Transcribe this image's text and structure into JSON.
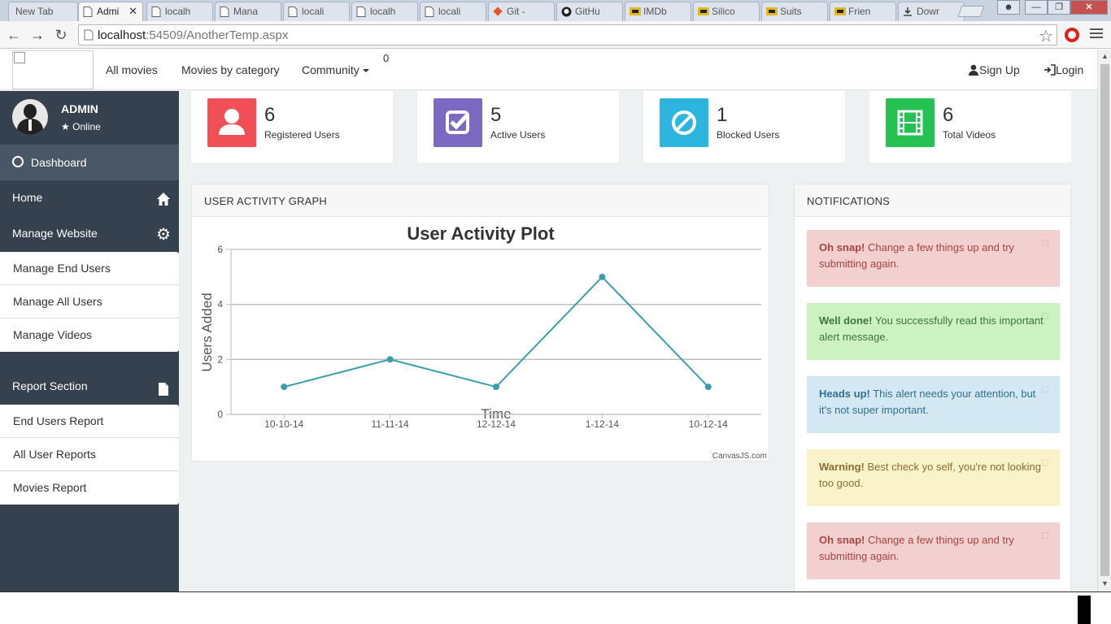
{
  "browser": {
    "tabs": [
      {
        "label": "New Tab",
        "icon": "none"
      },
      {
        "label": "Admi",
        "icon": "page-icon",
        "active": true
      },
      {
        "label": "localh",
        "icon": "page-icon"
      },
      {
        "label": "Mana",
        "icon": "page-icon"
      },
      {
        "label": "locali",
        "icon": "page-icon"
      },
      {
        "label": "localh",
        "icon": "page-icon"
      },
      {
        "label": "locali",
        "icon": "page-icon"
      },
      {
        "label": "Git -",
        "icon": "git-icon"
      },
      {
        "label": "GitHu",
        "icon": "github-icon"
      },
      {
        "label": "IMDb",
        "icon": "imdb-icon"
      },
      {
        "label": "Silico",
        "icon": "imdb-icon"
      },
      {
        "label": "Suits",
        "icon": "imdb-icon"
      },
      {
        "label": "Frien",
        "icon": "imdb-icon"
      },
      {
        "label": "Dowr",
        "icon": "download-icon"
      }
    ],
    "url_host": "localhost",
    "url_rest": ":54509/AnotherTemp.aspx"
  },
  "nav": {
    "all_movies": "All movies",
    "movies_by_category": "Movies by category",
    "community": "Community",
    "badge": "0",
    "sign_up": "Sign Up",
    "login": "Login"
  },
  "sidebar": {
    "user_name": "ADMIN",
    "status": "Online",
    "dashboard": "Dashboard",
    "home": "Home",
    "manage_website": "Manage Website",
    "manage_items": [
      "Manage End Users",
      "Manage All Users",
      "Manage Videos"
    ],
    "report_section": "Report Section",
    "report_items": [
      "End Users Report",
      "All User Reports",
      "Movies Report"
    ]
  },
  "stats": [
    {
      "value": "6",
      "label": "Registered Users",
      "color": "#ef4f55",
      "icon": "user-icon"
    },
    {
      "value": "5",
      "label": "Active Users",
      "color": "#7b68c0",
      "icon": "check-square-icon"
    },
    {
      "value": "1",
      "label": "Blocked Users",
      "color": "#2cb5de",
      "icon": "ban-icon"
    },
    {
      "value": "6",
      "label": "Total Videos",
      "color": "#26c153",
      "icon": "film-icon"
    }
  ],
  "graph_panel": {
    "heading": "USER ACTIVITY GRAPH",
    "credit": "CanvasJS.com"
  },
  "notifications": {
    "heading": "NOTIFICATIONS",
    "alerts": [
      {
        "title": "Oh snap!",
        "text": "Change a few things up and try submitting again.",
        "bg": "#f2d0d0",
        "fg": "#a94442"
      },
      {
        "title": "Well done!",
        "text": "You successfully read this important alert message.",
        "bg": "#ccf2c2",
        "fg": "#3c763d"
      },
      {
        "title": "Heads up!",
        "text": "This alert needs your attention, but it's not super important.",
        "bg": "#d3e8f3",
        "fg": "#31708f"
      },
      {
        "title": "Warning!",
        "text": "Best check yo self, you're not looking too good.",
        "bg": "#faf2c8",
        "fg": "#8a6d3b"
      },
      {
        "title": "Oh snap!",
        "text": "Change a few things up and try submitting again.",
        "bg": "#f2d0d0",
        "fg": "#a94442"
      }
    ]
  },
  "chart_data": {
    "type": "line",
    "title": "User Activity Plot",
    "xlabel": "Time",
    "ylabel": "Users Added",
    "categories": [
      "10-10-14",
      "11-11-14",
      "12-12-14",
      "1-12-14",
      "10-12-14"
    ],
    "values": [
      1,
      2,
      1,
      5,
      1
    ],
    "ylim": [
      0,
      6
    ],
    "yticks": [
      0,
      2,
      4,
      6
    ],
    "grid": true,
    "color": "#3a9faa"
  }
}
